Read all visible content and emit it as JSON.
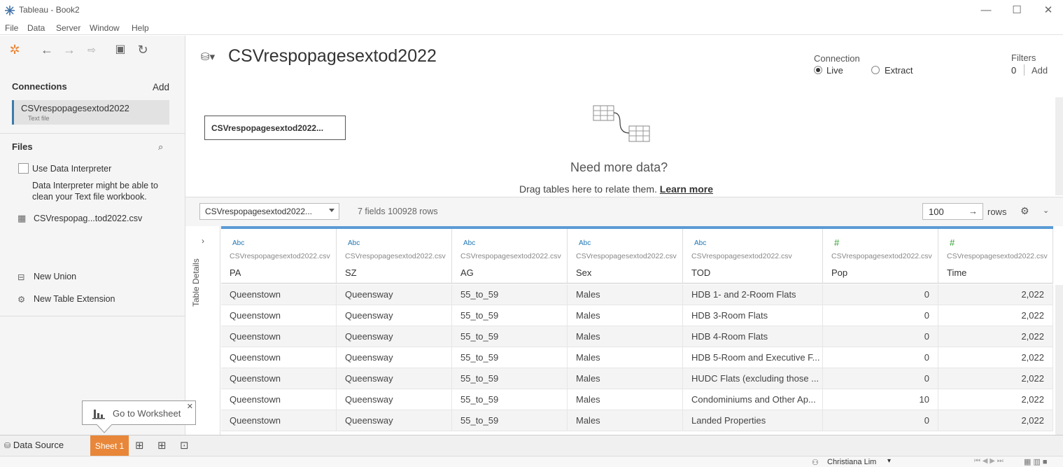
{
  "app": {
    "window_title": "Tableau - Book2"
  },
  "menu": [
    "File",
    "Data",
    "Server",
    "Window",
    "Help"
  ],
  "left": {
    "connections_title": "Connections",
    "add_label": "Add",
    "connection": {
      "name": "CSVrespopagesextod2022",
      "type": "Text file"
    },
    "files_title": "Files",
    "use_data_interpreter": "Use Data Interpreter",
    "interpreter_hint_1": "Data Interpreter might be able to",
    "interpreter_hint_2": "clean your Text file workbook.",
    "file_name": "CSVrespopag...tod2022.csv",
    "new_union": "New Union",
    "new_table_extension": "New Table Extension"
  },
  "canvas": {
    "datasource_title": "CSVrespopagesextod2022",
    "table_chip": "CSVrespopagesextod2022...",
    "need_more": "Need more data?",
    "drag_text": "Drag tables here to relate them.",
    "learn_more": "Learn more",
    "connection_label": "Connection",
    "live": "Live",
    "extract": "Extract",
    "filters_label": "Filters",
    "filters_count": "0",
    "filters_add": "Add"
  },
  "grid": {
    "table_select": "CSVrespopagesextod2022...",
    "summary": "7 fields 100928 rows",
    "rows_value": "100",
    "rows_label": "rows",
    "table_details": "Table Details",
    "columns": [
      {
        "type": "Abc",
        "source": "CSVrespopagesextod2022.csv",
        "name": "PA"
      },
      {
        "type": "Abc",
        "source": "CSVrespopagesextod2022.csv",
        "name": "SZ"
      },
      {
        "type": "Abc",
        "source": "CSVrespopagesextod2022.csv",
        "name": "AG"
      },
      {
        "type": "Abc",
        "source": "CSVrespopagesextod2022.csv",
        "name": "Sex"
      },
      {
        "type": "Abc",
        "source": "CSVrespopagesextod2022.csv",
        "name": "TOD"
      },
      {
        "type": "#",
        "source": "CSVrespopagesextod2022.csv",
        "name": "Pop"
      },
      {
        "type": "#",
        "source": "CSVrespopagesextod2022.csv",
        "name": "Time"
      }
    ],
    "rows": [
      [
        "Queenstown",
        "Queensway",
        "55_to_59",
        "Males",
        "HDB 1- and 2-Room Flats",
        "0",
        "2,022"
      ],
      [
        "Queenstown",
        "Queensway",
        "55_to_59",
        "Males",
        "HDB 3-Room Flats",
        "0",
        "2,022"
      ],
      [
        "Queenstown",
        "Queensway",
        "55_to_59",
        "Males",
        "HDB 4-Room Flats",
        "0",
        "2,022"
      ],
      [
        "Queenstown",
        "Queensway",
        "55_to_59",
        "Males",
        "HDB 5-Room and Executive F...",
        "0",
        "2,022"
      ],
      [
        "Queenstown",
        "Queensway",
        "55_to_59",
        "Males",
        "HUDC Flats (excluding those ...",
        "0",
        "2,022"
      ],
      [
        "Queenstown",
        "Queensway",
        "55_to_59",
        "Males",
        "Condominiums and Other Ap...",
        "10",
        "2,022"
      ],
      [
        "Queenstown",
        "Queensway",
        "55_to_59",
        "Males",
        "Landed Properties",
        "0",
        "2,022"
      ]
    ]
  },
  "bottom": {
    "data_source_tab": "Data Source",
    "sheet_tab": "Sheet 1",
    "tooltip": "Go to Worksheet",
    "user": "Christiana Lim"
  }
}
